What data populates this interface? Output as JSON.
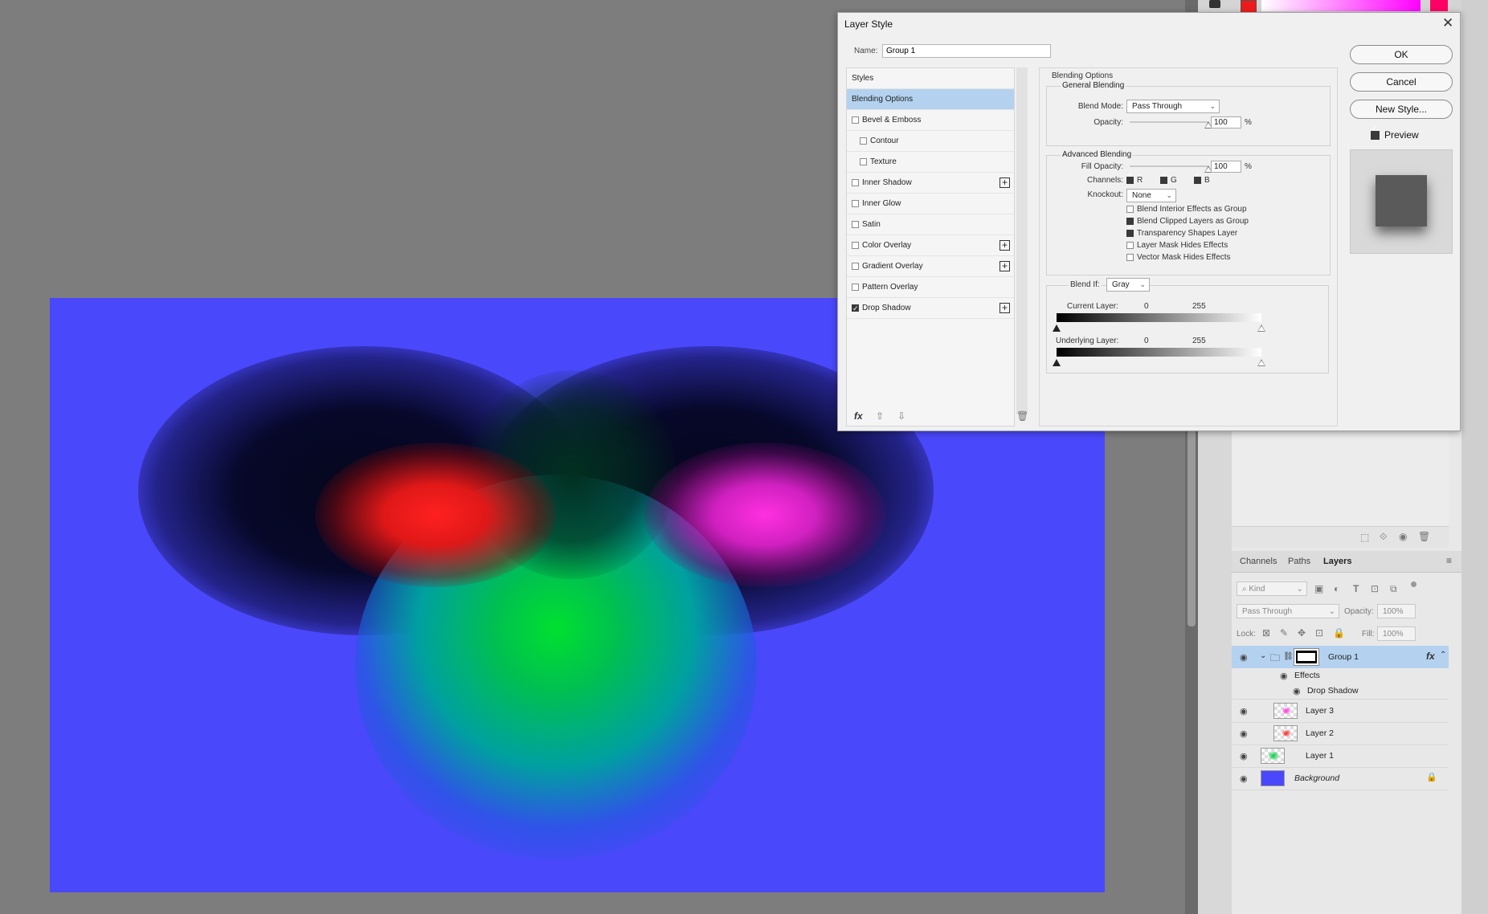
{
  "dialog": {
    "title": "Layer Style",
    "name_label": "Name:",
    "name_value": "Group 1",
    "buttons": {
      "ok": "OK",
      "cancel": "Cancel",
      "new_style": "New Style..."
    },
    "preview_label": "Preview",
    "preview_checked": true
  },
  "styles": [
    {
      "label": "Styles",
      "checkbox": false,
      "checked": false,
      "indent": false,
      "plus": false,
      "active": false
    },
    {
      "label": "Blending Options",
      "checkbox": false,
      "checked": false,
      "indent": false,
      "plus": false,
      "active": true
    },
    {
      "label": "Bevel & Emboss",
      "checkbox": true,
      "checked": false,
      "indent": false,
      "plus": false,
      "active": false
    },
    {
      "label": "Contour",
      "checkbox": true,
      "checked": false,
      "indent": true,
      "plus": false,
      "active": false
    },
    {
      "label": "Texture",
      "checkbox": true,
      "checked": false,
      "indent": true,
      "plus": false,
      "active": false
    },
    {
      "label": "Inner Shadow",
      "checkbox": true,
      "checked": false,
      "indent": false,
      "plus": true,
      "active": false
    },
    {
      "label": "Inner Glow",
      "checkbox": true,
      "checked": false,
      "indent": false,
      "plus": false,
      "active": false
    },
    {
      "label": "Satin",
      "checkbox": true,
      "checked": false,
      "indent": false,
      "plus": false,
      "active": false
    },
    {
      "label": "Color Overlay",
      "checkbox": true,
      "checked": false,
      "indent": false,
      "plus": true,
      "active": false
    },
    {
      "label": "Gradient Overlay",
      "checkbox": true,
      "checked": false,
      "indent": false,
      "plus": true,
      "active": false
    },
    {
      "label": "Pattern Overlay",
      "checkbox": true,
      "checked": false,
      "indent": false,
      "plus": false,
      "active": false
    },
    {
      "label": "Drop Shadow",
      "checkbox": true,
      "checked": true,
      "indent": false,
      "plus": true,
      "active": false
    }
  ],
  "blending": {
    "section_title": "Blending Options",
    "general_title": "General Blending",
    "blend_mode_label": "Blend Mode:",
    "blend_mode_value": "Pass Through",
    "opacity_label": "Opacity:",
    "opacity_value": "100",
    "percent": "%",
    "advanced_title": "Advanced Blending",
    "fill_opacity_label": "Fill Opacity:",
    "fill_opacity_value": "100",
    "channels_label": "Channels:",
    "channels": [
      {
        "label": "R",
        "checked": true
      },
      {
        "label": "G",
        "checked": true
      },
      {
        "label": "B",
        "checked": true
      }
    ],
    "knockout_label": "Knockout:",
    "knockout_value": "None",
    "options": [
      {
        "label": "Blend Interior Effects as Group",
        "checked": false
      },
      {
        "label": "Blend Clipped Layers as Group",
        "checked": true
      },
      {
        "label": "Transparency Shapes Layer",
        "checked": true
      },
      {
        "label": "Layer Mask Hides Effects",
        "checked": false
      },
      {
        "label": "Vector Mask Hides Effects",
        "checked": false
      }
    ],
    "blend_if_label": "Blend If:",
    "blend_if_value": "Gray",
    "current_layer_label": "Current Layer:",
    "underlying_layer_label": "Underlying Layer:",
    "range_min": "0",
    "range_max": "255"
  },
  "layers_panel": {
    "tabs": [
      "Channels",
      "Paths",
      "Layers"
    ],
    "active_tab": "Layers",
    "kind_placeholder": "Kind",
    "blend_mode": "Pass Through",
    "opacity_label": "Opacity:",
    "opacity_value": "100%",
    "lock_label": "Lock:",
    "fill_label": "Fill:",
    "fill_value": "100%",
    "group_name": "Group 1",
    "effects_label": "Effects",
    "drop_shadow_label": "Drop Shadow",
    "layers": [
      {
        "name": "Layer 3"
      },
      {
        "name": "Layer 2"
      },
      {
        "name": "Layer 1"
      },
      {
        "name": "Background",
        "locked": true
      }
    ]
  },
  "colors": {
    "canvas_bg": "#4a48fb",
    "selection": "#b4d2f0",
    "foreground_swatch": "#ee1b1b",
    "accent_pink": "#ff0066"
  }
}
